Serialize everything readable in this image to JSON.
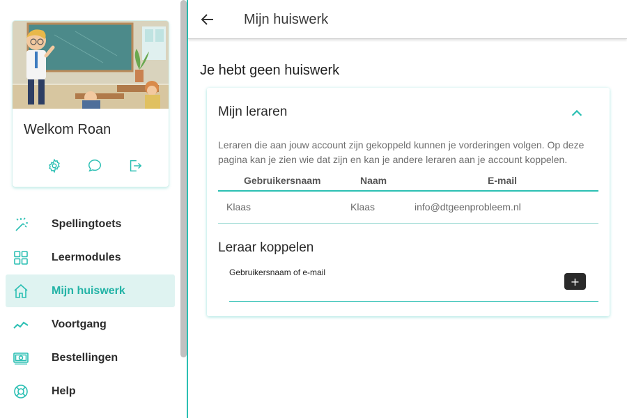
{
  "sidebar": {
    "welcome": "Welkom Roan",
    "card_icons": [
      "settings-icon",
      "chat-icon",
      "logout-icon"
    ],
    "items": [
      {
        "label": "Spellingtoets",
        "icon": "magic-wand-icon",
        "active": false
      },
      {
        "label": "Leermodules",
        "icon": "grid-icon",
        "active": false
      },
      {
        "label": "Mijn huiswerk",
        "icon": "home-icon",
        "active": true
      },
      {
        "label": "Voortgang",
        "icon": "trend-icon",
        "active": false
      },
      {
        "label": "Bestellingen",
        "icon": "money-icon",
        "active": false
      },
      {
        "label": "Help",
        "icon": "lifebuoy-icon",
        "active": false
      }
    ]
  },
  "topbar": {
    "title": "Mijn huiswerk",
    "back_icon": "arrow-left-icon"
  },
  "main": {
    "heading": "Je hebt geen huiswerk",
    "teachers_panel": {
      "title": "Mijn leraren",
      "description": "Leraren die aan jouw account zijn gekoppeld kunnen je vorderingen volgen. Op deze pagina kan je zien wie dat zijn en kan je andere leraren aan je account koppelen.",
      "columns": [
        "Gebruikersnaam",
        "Naam",
        "E-mail"
      ],
      "rows": [
        [
          "Klaas",
          "Klaas",
          "info@dtgeenprobleem.nl"
        ]
      ],
      "link_title": "Leraar koppelen",
      "link_field_label": "Gebruikersnaam of e-mail",
      "link_field_value": "",
      "add_button": "+"
    }
  },
  "colors": {
    "accent": "#2bbfb3",
    "active_bg": "#dff3f1",
    "button_dark": "#2a2a2a"
  }
}
